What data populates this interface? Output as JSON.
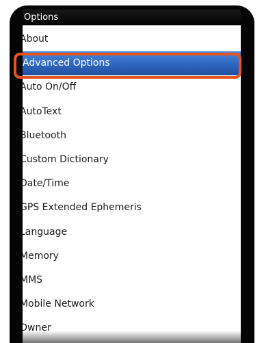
{
  "title": "Options",
  "accent_color": "#2f66bf",
  "annotation_color": "#e8551f",
  "selected_index": 1,
  "items": [
    {
      "label": "About"
    },
    {
      "label": "Advanced Options"
    },
    {
      "label": "Auto On/Off"
    },
    {
      "label": "AutoText"
    },
    {
      "label": "Bluetooth"
    },
    {
      "label": "Custom Dictionary"
    },
    {
      "label": "Date/Time"
    },
    {
      "label": "GPS Extended Ephemeris"
    },
    {
      "label": "Language"
    },
    {
      "label": "Memory"
    },
    {
      "label": "MMS"
    },
    {
      "label": "Mobile Network"
    },
    {
      "label": "Owner"
    }
  ]
}
